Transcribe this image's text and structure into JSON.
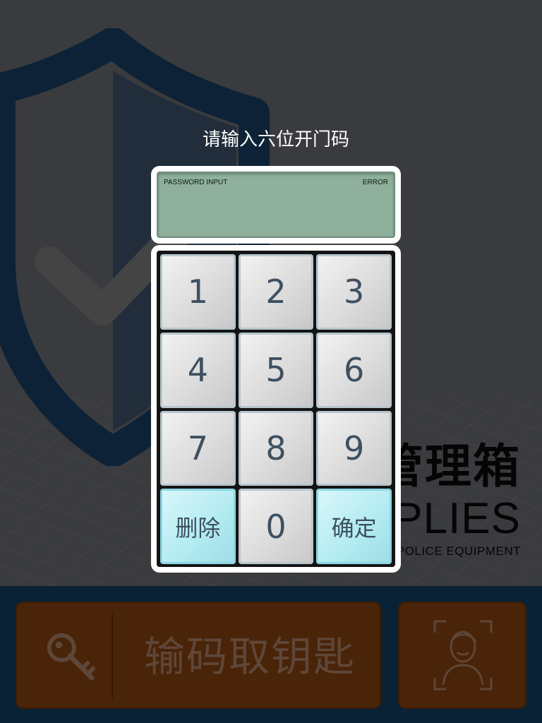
{
  "background": {
    "brand_cn": "管理箱",
    "brand_en": "PPLIES",
    "brand_sub": "POLICE EQUIPMENT",
    "key_button_label": "输码取钥匙",
    "colors": {
      "overlay": "#3a3b3e",
      "bottom_bar": "#0a2236",
      "button_fill": "#4a2408",
      "shield": "#0d2236"
    },
    "icons": [
      "shield-check-icon",
      "key-icon",
      "face-scan-icon"
    ]
  },
  "modal": {
    "prompt": "请输入六位开门码",
    "display": {
      "title": "PASSWORD INPUT",
      "status": "ERROR",
      "value": ""
    },
    "keys": [
      {
        "label": "1",
        "type": "digit"
      },
      {
        "label": "2",
        "type": "digit"
      },
      {
        "label": "3",
        "type": "digit"
      },
      {
        "label": "4",
        "type": "digit"
      },
      {
        "label": "5",
        "type": "digit"
      },
      {
        "label": "6",
        "type": "digit"
      },
      {
        "label": "7",
        "type": "digit"
      },
      {
        "label": "8",
        "type": "digit"
      },
      {
        "label": "9",
        "type": "digit"
      },
      {
        "label": "删除",
        "type": "delete"
      },
      {
        "label": "0",
        "type": "digit"
      },
      {
        "label": "确定",
        "type": "confirm"
      }
    ],
    "colors": {
      "lcd": "#8fb09c",
      "key": "#dcdcdc",
      "key_text": "#3e5060",
      "action_key": "#b4ecf2"
    }
  }
}
